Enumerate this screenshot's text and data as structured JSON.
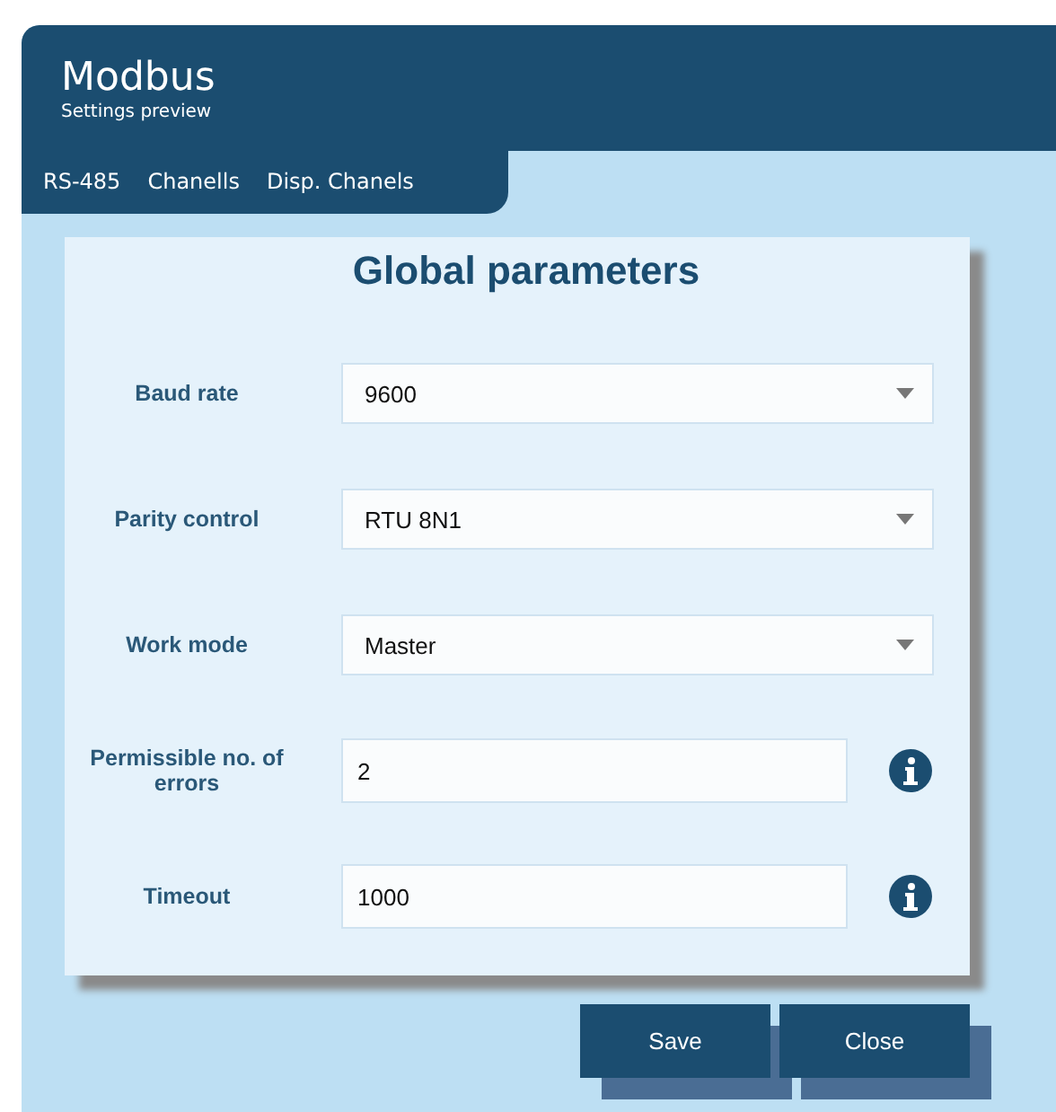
{
  "header": {
    "title": "Modbus",
    "subtitle": "Settings preview"
  },
  "tabs": [
    {
      "label": "RS-485",
      "selected": false
    },
    {
      "label": "Chanells",
      "selected": false
    },
    {
      "label": "Disp. Chanels",
      "selected": false
    }
  ],
  "panel": {
    "title": "Global parameters",
    "fields": [
      {
        "label": "Baud rate",
        "kind": "select",
        "value": "9600"
      },
      {
        "label": "Parity control",
        "kind": "select",
        "value": "RTU 8N1"
      },
      {
        "label": "Work mode",
        "kind": "select",
        "value": "Master"
      },
      {
        "label": "Permissible no. of errors",
        "kind": "text",
        "value": "2",
        "info": true
      },
      {
        "label": "Timeout",
        "kind": "text",
        "value": "1000",
        "info": true
      }
    ]
  },
  "buttons": [
    "Save",
    "Close"
  ]
}
